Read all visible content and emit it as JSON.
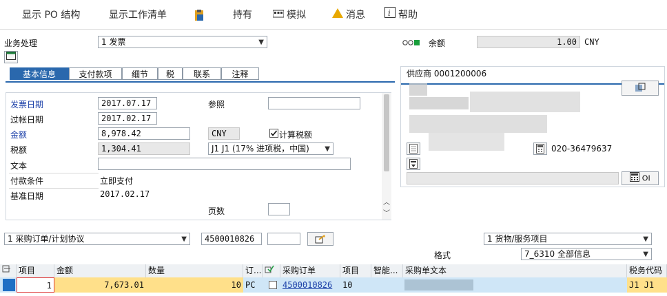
{
  "toolbar": {
    "show_po_structure": "显示 PO 结构",
    "show_worklist": "显示工作清单",
    "hold": "持有",
    "simulate": "模拟",
    "messages": "消息",
    "help": "帮助"
  },
  "header": {
    "transaction_label": "业务处理",
    "transaction_value": "1 发票",
    "balance_label": "余额",
    "balance_value": "1.00",
    "balance_currency": "CNY"
  },
  "tabs": [
    "基本信息",
    "支付款项",
    "细节",
    "税",
    "联系",
    "注释"
  ],
  "basic": {
    "invoice_date_label": "发票日期",
    "invoice_date": "2017.07.17",
    "reference_label": "参照",
    "reference_value": "",
    "posting_date_label": "过帐日期",
    "posting_date": "2017.02.17",
    "amount_label": "金额",
    "amount": "8,978.42",
    "currency": "CNY",
    "calc_tax_label": "计算税额",
    "tax_amount_label": "税额",
    "tax_amount": "1,304.41",
    "tax_code": "J1 J1 (17% 进项税，中国)",
    "text_label": "文本",
    "text_value": "",
    "payment_terms_label": "付款条件",
    "payment_terms_value": "立即支付",
    "baseline_date_label": "基准日期",
    "baseline_date": "2017.02.17",
    "page_count_label": "页数",
    "page_count_value": ""
  },
  "vendor": {
    "title": "供应商 0001200006",
    "phone": "020-36479637",
    "oi_label": "OI"
  },
  "reference_bar": {
    "ref_doc_type": "1 采购订单/计划协议",
    "po_number": "4500010826",
    "item_input": "",
    "line_type": "1 货物/服务项目",
    "layout_label": "格式",
    "layout_value": "7_6310 全部信息"
  },
  "grid": {
    "columns": [
      "项目",
      "金额",
      "数量",
      "订...",
      "采购订单",
      "项目",
      "智能...",
      "采购单文本",
      "税务代码"
    ],
    "rows": [
      {
        "item": "1",
        "amount": "7,673.01",
        "quantity": "10",
        "unit": "PC",
        "po": "4500010826",
        "po_item": "10",
        "smart": "",
        "po_text": "",
        "tax_code": "J1 J1"
      }
    ]
  },
  "colors": {
    "accent_blue": "#2a68ad",
    "row_highlight": "#cfe6f7",
    "input_yellow": "#ffe08a"
  }
}
